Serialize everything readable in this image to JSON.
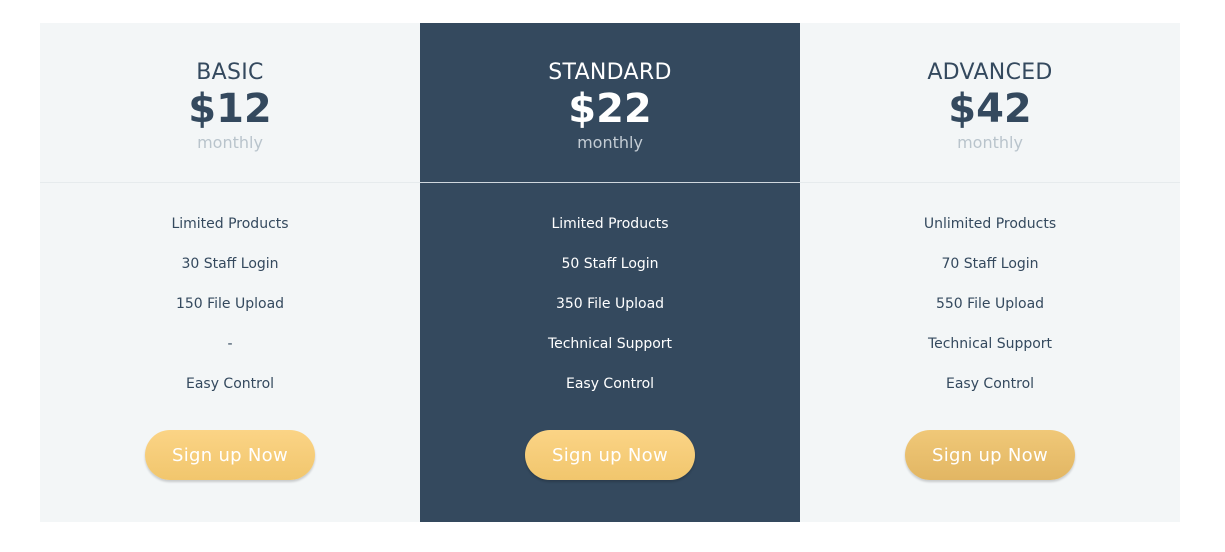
{
  "plans": [
    {
      "name": "BASIC",
      "price": "$12",
      "period": "monthly",
      "features": [
        "Limited Products",
        "30 Staff Login",
        "150 File Upload",
        "-",
        "Easy Control"
      ],
      "button_label": "Sign up Now"
    },
    {
      "name": "STANDARD",
      "price": "$22",
      "period": "monthly",
      "features": [
        "Limited Products",
        "50 Staff Login",
        "350 File Upload",
        "Technical Support",
        "Easy Control"
      ],
      "button_label": "Sign up Now"
    },
    {
      "name": "ADVANCED",
      "price": "$42",
      "period": "monthly",
      "features": [
        "Unlimited Products",
        "70 Staff Login",
        "550 File Upload",
        "Technical Support",
        "Easy Control"
      ],
      "button_label": "Sign up Now"
    }
  ],
  "colors": {
    "panel_light": "#f3f6f7",
    "panel_dark": "#34495e",
    "text_dark": "#34495e",
    "muted": "#b9c4cc",
    "button": "#f5c972"
  }
}
